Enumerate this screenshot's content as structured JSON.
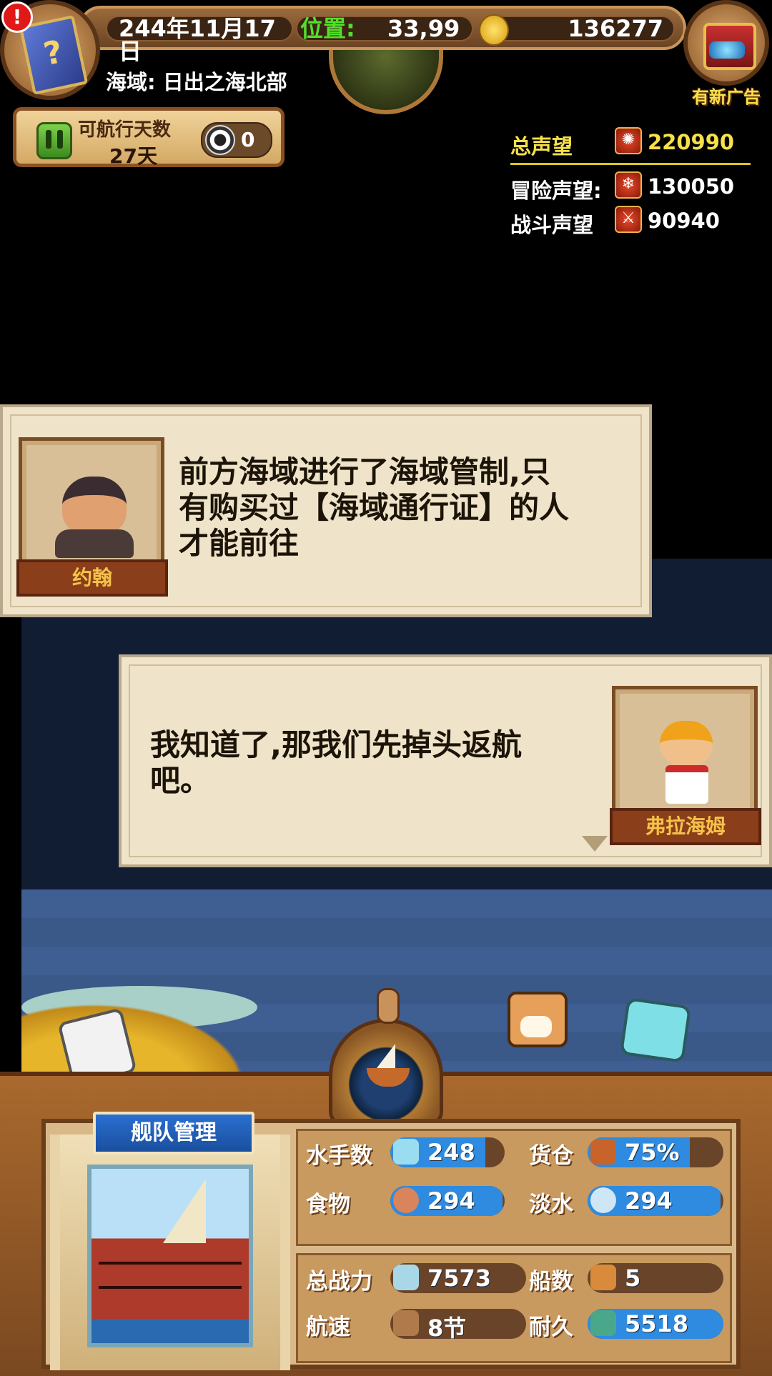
{
  "header": {
    "date": "244年11月17日",
    "position_label": "位置:",
    "position_value": "33,99",
    "gold": "136277",
    "region": "海域: 日出之海北部",
    "ad_label": "有新广告",
    "alert": "!",
    "book_glyph": "?"
  },
  "voyage": {
    "days_label": "可航行天数",
    "days_value": "27天",
    "token_count": "0"
  },
  "reputation": {
    "total_label": "总声望",
    "total_value": "220990",
    "adventure_label": "冒险声望:",
    "adventure_value": "130050",
    "battle_label": "战斗声望",
    "battle_value": "90940",
    "colors": {
      "total": "#f7e14a",
      "other": "#ffffff"
    }
  },
  "dialogs": [
    {
      "speaker": "约翰",
      "text_lines": [
        "前方海域进行了海域管制,只",
        "有购买过【海域通行证】的人",
        "才能前往"
      ]
    },
    {
      "speaker": "弗拉海姆",
      "text_lines": [
        "我知道了,那我们先掉头返航",
        "吧。"
      ]
    }
  ],
  "fleet": {
    "title": "舰队管理",
    "stats": {
      "sailors_label": "水手数",
      "sailors_value": "248",
      "sailors_fill": 0.83,
      "cargo_label": "货仓",
      "cargo_value": "75%",
      "cargo_fill": 0.75,
      "food_label": "食物",
      "food_value": "294",
      "food_fill": 0.98,
      "water_label": "淡水",
      "water_value": "294",
      "water_fill": 0.98,
      "power_label": "总战力",
      "power_value": "7573",
      "power_fill": 0.0,
      "ships_label": "船数",
      "ships_value": "5",
      "ships_fill": 0.0,
      "speed_label": "航速",
      "speed_value": "8节",
      "speed_fill": 0.0,
      "durability_label": "耐久",
      "durability_value": "5518",
      "durability_fill": 1.0
    }
  },
  "colors": {
    "accent_blue": "#2f8be0",
    "wood": "#8a5224",
    "parchment": "#efe3c9",
    "name_gold": "#f5c24a"
  },
  "icons": [
    "alert-icon",
    "book-icon",
    "gold-coin-icon",
    "globe-icon",
    "treasure-chest-icon",
    "pause-icon",
    "token-icon",
    "reputation-icon",
    "sailor-icon",
    "cargo-icon",
    "meat-icon",
    "water-jug-icon",
    "swords-icon",
    "ship-icon",
    "anchor-icon",
    "helm-icon"
  ]
}
